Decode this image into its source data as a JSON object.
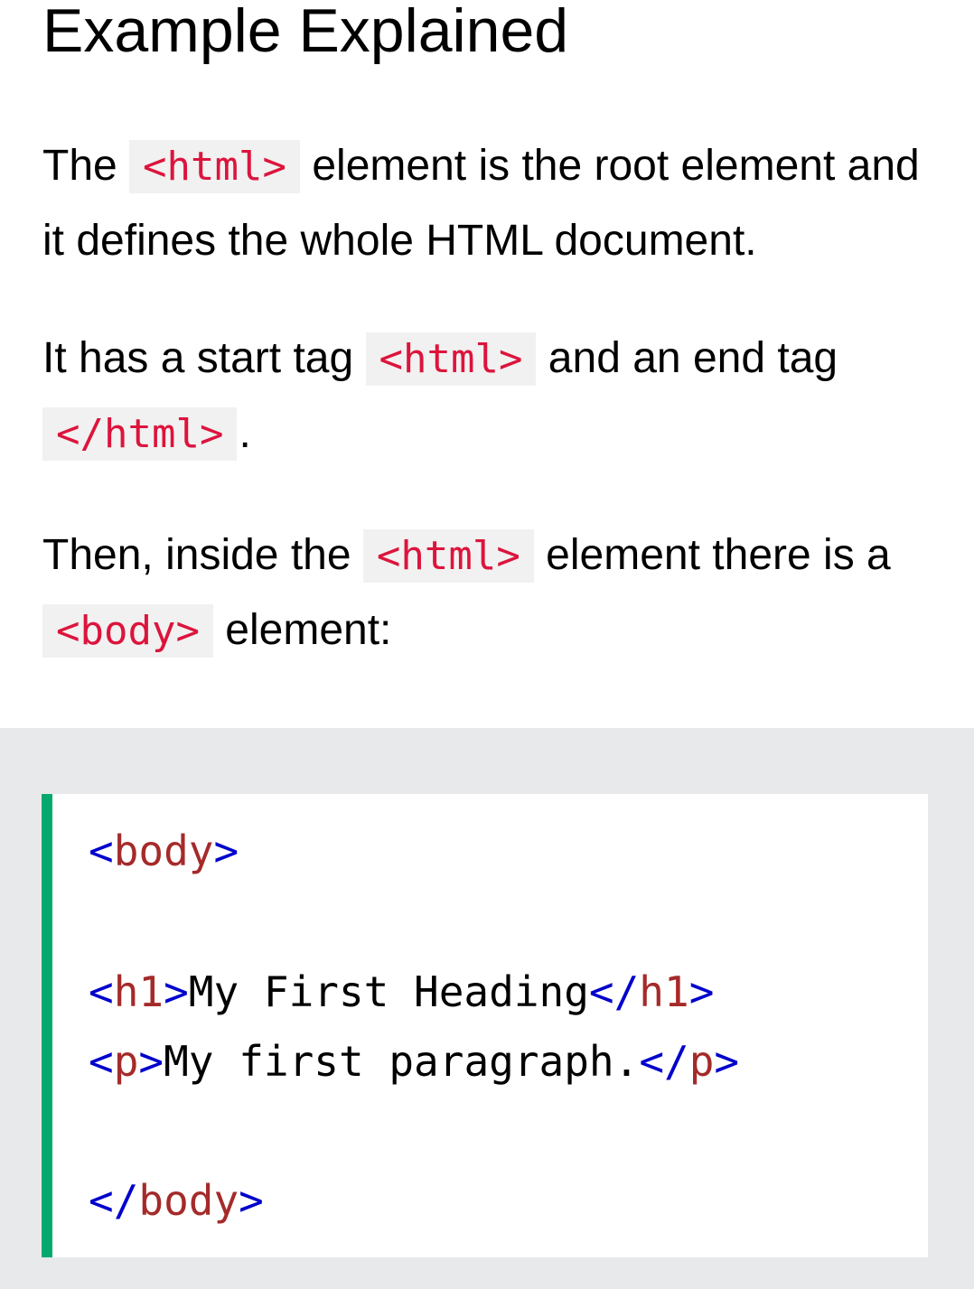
{
  "title": "Example Explained",
  "paragraphs": {
    "p1": {
      "pre": "The ",
      "code": "<html>",
      "post": " element is the root element and it defines the whole HTML document."
    },
    "p2": {
      "pre": "It has a start tag ",
      "code1": "<html>",
      "mid": " and an end tag ",
      "code2": "</html>",
      "post": "."
    },
    "p3": {
      "pre": "Then, inside the ",
      "code1": "<html>",
      "mid": " element there is a ",
      "code2": "<body>",
      "post": " element:"
    }
  },
  "code_example": {
    "line1": {
      "open": "<",
      "tag": "body",
      "close": ">"
    },
    "line2": {
      "open": "<",
      "tag": "h1",
      "close": ">",
      "text": "My First Heading",
      "end_open": "</",
      "end_tag": "h1",
      "end_close": ">"
    },
    "line3": {
      "open": "<",
      "tag": "p",
      "close": ">",
      "text": "My first paragraph.",
      "end_open": "</",
      "end_tag": "p",
      "end_close": ">"
    },
    "line4": {
      "open": "</",
      "tag": "body",
      "close": ">"
    }
  },
  "colors": {
    "inline_code_text": "#dc143c",
    "inline_code_bg": "#f1f1f1",
    "example_bg": "#e7e9eb",
    "accent_border": "#04aa6d",
    "tag_bracket": "#0000cd",
    "tag_name": "#a52a2a"
  }
}
